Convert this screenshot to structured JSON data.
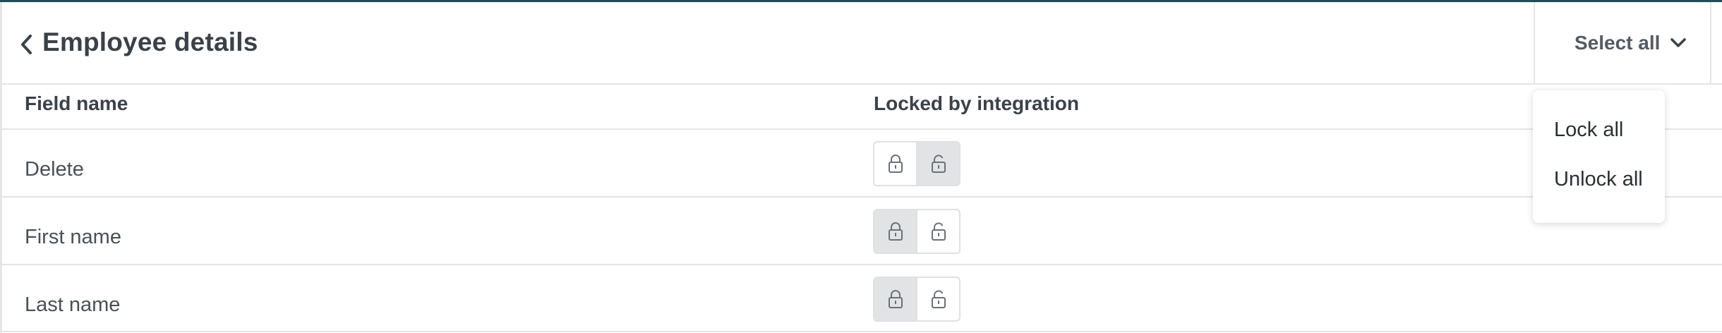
{
  "header": {
    "title": "Employee details",
    "select_all_label": "Select all"
  },
  "columns": {
    "field_name": "Field name",
    "locked_by_integration": "Locked by integration"
  },
  "rows": [
    {
      "label": "Delete",
      "state": "unlocked"
    },
    {
      "label": "First name",
      "state": "locked"
    },
    {
      "label": "Last name",
      "state": "locked"
    }
  ],
  "dropdown": {
    "items": [
      "Lock all",
      "Unlock all"
    ]
  },
  "icons": {
    "back": "chevron-left-icon",
    "select_chevron": "chevron-down-icon",
    "lock": "lock-icon",
    "unlock": "unlock-icon"
  },
  "colors": {
    "accent_topline": "#1f4e55",
    "text": "#3b4148",
    "border": "#e3e5e7",
    "active_segment": "#e2e3e5",
    "icon": "#6b7177"
  }
}
